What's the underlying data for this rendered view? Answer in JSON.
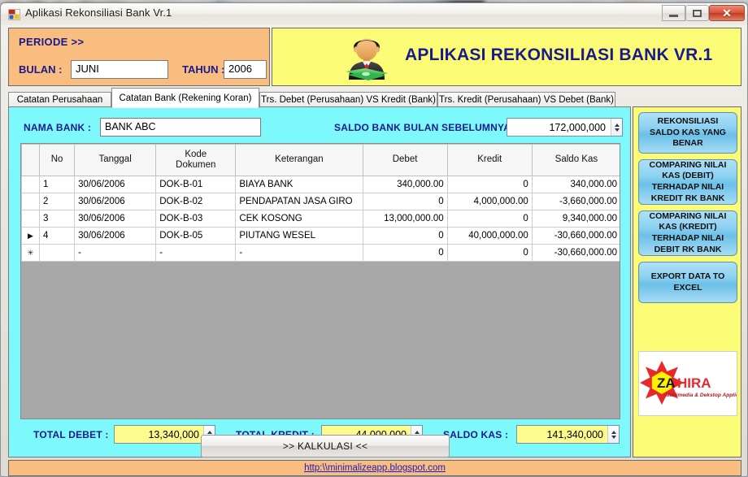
{
  "window": {
    "title": "Aplikasi Rekonsiliasi Bank Vr.1",
    "icon": "vb-form-icon",
    "controls": {
      "minimize": "minimize-icon",
      "maximize": "maximize-icon",
      "close": "✕"
    }
  },
  "header": {
    "periode_label": "PERIODE >>",
    "bulan_label": "BULAN :",
    "bulan_value": "JUNI",
    "bulan_placeholder": "",
    "tahun_label": "TAHUN :",
    "tahun_value": "2006",
    "tahun_placeholder": "",
    "banner_title": "APLIKASI REKONSILIASI BANK VR.1",
    "banner_icon": "businessman-with-money-icon",
    "periode_bg": "#f8bd7f",
    "banner_bg": "#fcfb76",
    "title_color": "#1a1a8c"
  },
  "tabs": [
    {
      "label": "Catatan Perusahaan",
      "active": false
    },
    {
      "label": "Catatan Bank (Rekening Koran)",
      "active": true
    },
    {
      "label": "Trs. Debet (Perusahaan) VS Kredit (Bank)",
      "active": false
    },
    {
      "label": "Trs. Kredit (Perusahaan) VS Debet (Bank)",
      "active": false
    }
  ],
  "panel": {
    "bg": "#7df9fb",
    "nama_bank_label": "NAMA BANK :",
    "nama_bank_value": "BANK ABC",
    "nama_bank_placeholder": "",
    "saldo_label": "SALDO BANK BULAN SEBELUMNYA :",
    "saldo_value": "172,000,000"
  },
  "grid": {
    "columns": [
      "No",
      "Tanggal",
      "Kode\nDokumen",
      "Keterangan",
      "Debet",
      "Kredit",
      "Saldo Kas"
    ],
    "column_headers": {
      "no": "No",
      "tanggal": "Tanggal",
      "kode_dokumen_line1": "Kode",
      "kode_dokumen_line2": "Dokumen",
      "keterangan": "Keterangan",
      "debet": "Debet",
      "kredit": "Kredit",
      "saldo_kas": "Saldo Kas"
    },
    "rows": [
      {
        "marker": "",
        "no": "1",
        "tanggal": "30/06/2006",
        "kode": "DOK-B-01",
        "keterangan": "BIAYA BANK",
        "debet": "340,000.00",
        "kredit": "0",
        "saldo": "340,000.00",
        "active_cell": null
      },
      {
        "marker": "",
        "no": "2",
        "tanggal": "30/06/2006",
        "kode": "DOK-B-02",
        "keterangan": "PENDAPATAN JASA GIRO",
        "debet": "0",
        "kredit": "4,000,000.00",
        "saldo": "-3,660,000.00",
        "active_cell": null
      },
      {
        "marker": "",
        "no": "3",
        "tanggal": "30/06/2006",
        "kode": "DOK-B-03",
        "keterangan": "CEK KOSONG",
        "debet": "13,000,000.00",
        "kredit": "0",
        "saldo": "9,340,000.00",
        "active_cell": null
      },
      {
        "marker": "▶",
        "no": "4",
        "tanggal": "30/06/2006",
        "kode": "DOK-B-05",
        "keterangan": "PIUTANG WESEL",
        "debet": "0",
        "kredit": "40,000,000.00",
        "saldo": "-30,660,000.00",
        "active_cell": "debet"
      },
      {
        "marker": "✳",
        "no": "",
        "tanggal": "-",
        "kode": "-",
        "keterangan": "-",
        "debet": "0",
        "kredit": "0",
        "saldo": "-30,660,000.00",
        "active_cell": null
      }
    ],
    "selected_cell_color": "#2e8ded",
    "highlight_cell_color": "#fdfa8e"
  },
  "totals": {
    "total_debet_label": "TOTAL DEBET :",
    "total_debet_value": "13,340,000",
    "total_kredit_label": "TOTAL KREDIT :",
    "total_kredit_value": "44,000,000",
    "saldo_kas_label": "SALDO KAS :",
    "saldo_kas_value": "141,340,000"
  },
  "kalkulasi_button": ">> KALKULASI <<",
  "sidebar": {
    "bg": "#fcfb76",
    "buttons": [
      {
        "label": "REKONSILIASI SALDO KAS YANG BENAR"
      },
      {
        "label": "COMPARING NILAI KAS (DEBIT) TERHADAP NILAI KREDIT RK BANK"
      },
      {
        "label": "COMPARING NILAI KAS (KREDIT) TERHADAP NILAI DEBIT RK BANK"
      },
      {
        "label": "EXPORT DATA TO EXCEL"
      }
    ],
    "logo": {
      "name": "zahira-logo",
      "text_dark": "ZA",
      "text_red": "HIRA",
      "tagline": "Multimedia & Dekstop Application",
      "star_color": "#e8282b",
      "core_color": "#fff200"
    }
  },
  "footer": {
    "link": "http:\\\\minimalizeapp.blogspot.com",
    "bg": "#f8bd7f"
  }
}
